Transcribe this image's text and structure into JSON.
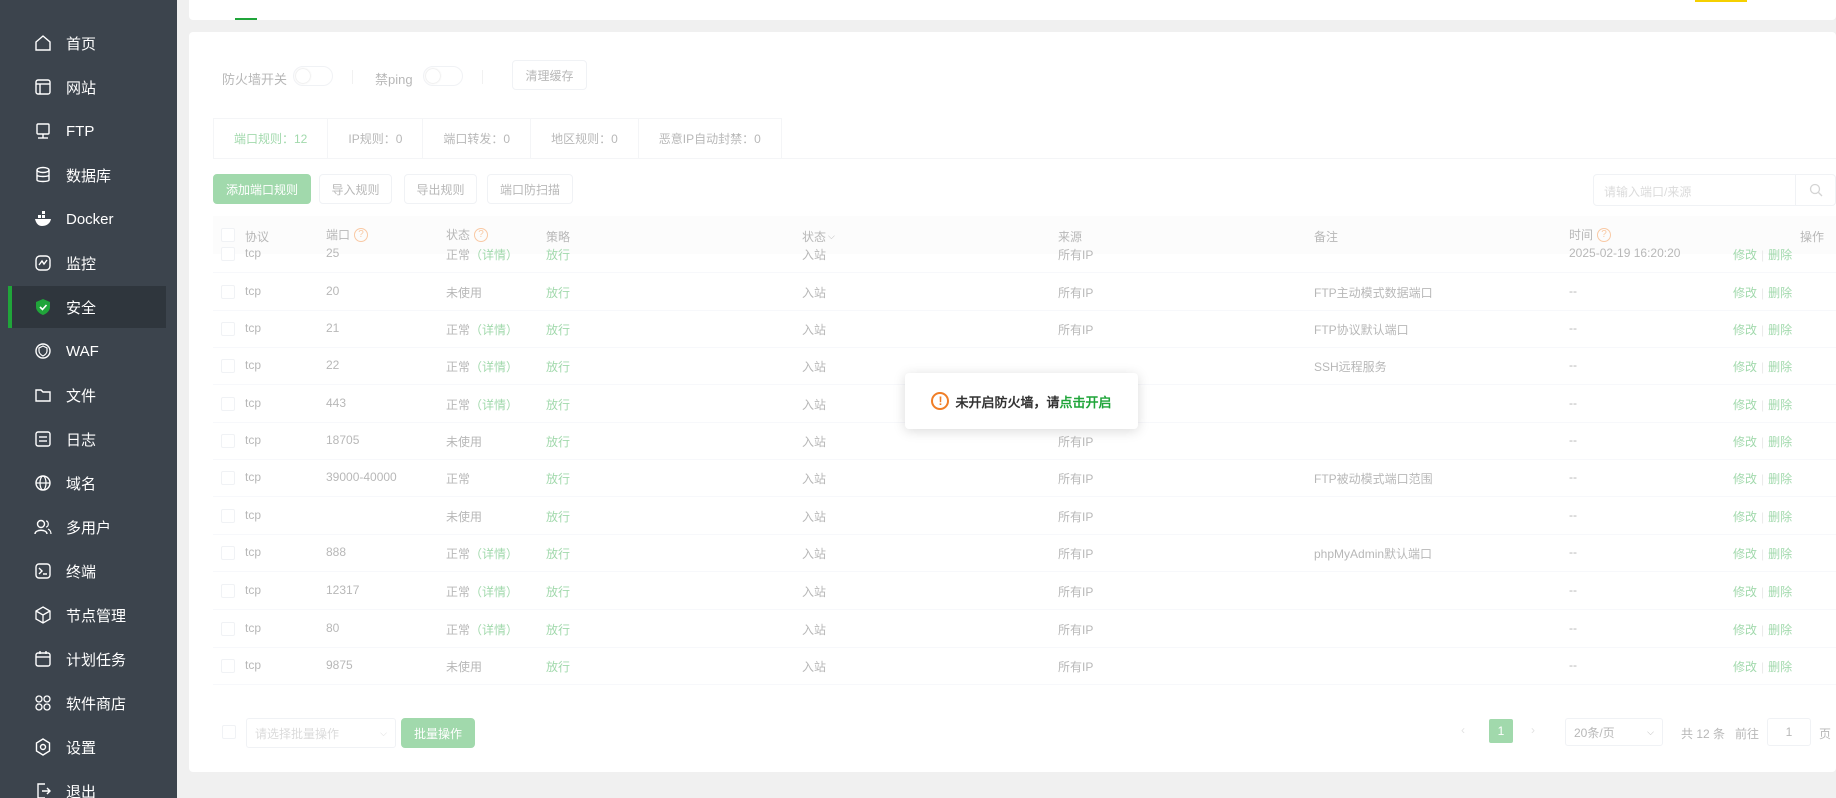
{
  "sidebar": {
    "items": [
      {
        "label": "首页",
        "icon": "home-icon",
        "active": false
      },
      {
        "label": "网站",
        "icon": "website-icon",
        "active": false
      },
      {
        "label": "FTP",
        "icon": "ftp-icon",
        "active": false
      },
      {
        "label": "数据库",
        "icon": "database-icon",
        "active": false
      },
      {
        "label": "Docker",
        "icon": "docker-icon",
        "active": false
      },
      {
        "label": "监控",
        "icon": "monitor-icon",
        "active": false
      },
      {
        "label": "安全",
        "icon": "shield-icon",
        "active": true
      },
      {
        "label": "WAF",
        "icon": "waf-icon",
        "active": false
      },
      {
        "label": "文件",
        "icon": "folder-icon",
        "active": false
      },
      {
        "label": "日志",
        "icon": "log-icon",
        "active": false
      },
      {
        "label": "域名",
        "icon": "globe-icon",
        "active": false
      },
      {
        "label": "多用户",
        "icon": "users-icon",
        "active": false
      },
      {
        "label": "终端",
        "icon": "terminal-icon",
        "active": false
      },
      {
        "label": "节点管理",
        "icon": "cube-icon",
        "active": false
      },
      {
        "label": "计划任务",
        "icon": "calendar-icon",
        "active": false
      },
      {
        "label": "软件商店",
        "icon": "apps-icon",
        "active": false
      },
      {
        "label": "设置",
        "icon": "gear-icon",
        "active": false
      },
      {
        "label": "退出",
        "icon": "logout-icon",
        "active": false
      }
    ]
  },
  "toolbar": {
    "firewall_label": "防火墙开关",
    "ping_label": "禁ping",
    "clear_cache": "清理缓存"
  },
  "tabs": [
    {
      "label": "端口规则：12",
      "active": true
    },
    {
      "label": "IP规则：0",
      "active": false
    },
    {
      "label": "端口转发：0",
      "active": false
    },
    {
      "label": "地区规则：0",
      "active": false
    },
    {
      "label": "恶意IP自动封禁：0",
      "active": false
    }
  ],
  "actions": {
    "add": "添加端口规则",
    "import": "导入规则",
    "export": "导出规则",
    "scan": "端口防扫描"
  },
  "search": {
    "placeholder": "请输入端口/来源"
  },
  "table": {
    "headers": {
      "protocol": "协议",
      "port": "端口",
      "status": "状态",
      "policy": "策略",
      "direction": "状态",
      "source": "来源",
      "remark": "备注",
      "time": "时间",
      "ops": "操作"
    },
    "rows": [
      {
        "protocol": "tcp",
        "port": "25",
        "status": "正常",
        "detail": "（详情）",
        "policy": "放行",
        "direction": "入站",
        "source": "所有IP",
        "remark": "",
        "time": "2025-02-19 16:20:20"
      },
      {
        "protocol": "tcp",
        "port": "20",
        "status": "未使用",
        "detail": "",
        "policy": "放行",
        "direction": "入站",
        "source": "所有IP",
        "remark": "FTP主动模式数据端口",
        "time": "--"
      },
      {
        "protocol": "tcp",
        "port": "21",
        "status": "正常",
        "detail": "（详情）",
        "policy": "放行",
        "direction": "入站",
        "source": "所有IP",
        "remark": "FTP协议默认端口",
        "time": "--"
      },
      {
        "protocol": "tcp",
        "port": "22",
        "status": "正常",
        "detail": "（详情）",
        "policy": "放行",
        "direction": "入站",
        "source": "",
        "remark": "SSH远程服务",
        "time": "--"
      },
      {
        "protocol": "tcp",
        "port": "443",
        "status": "正常",
        "detail": "（详情）",
        "policy": "放行",
        "direction": "入站",
        "source": "",
        "remark": "",
        "time": "--"
      },
      {
        "protocol": "tcp",
        "port": "18705",
        "status": "未使用",
        "detail": "",
        "policy": "放行",
        "direction": "入站",
        "source": "所有IP",
        "remark": "",
        "time": "--"
      },
      {
        "protocol": "tcp",
        "port": "39000-40000",
        "status": "正常",
        "detail": "",
        "policy": "放行",
        "direction": "入站",
        "source": "所有IP",
        "remark": "FTP被动模式端口范围",
        "time": "--"
      },
      {
        "protocol": "tcp",
        "port": "",
        "status": "未使用",
        "detail": "",
        "policy": "放行",
        "direction": "入站",
        "source": "所有IP",
        "remark": "",
        "time": "--"
      },
      {
        "protocol": "tcp",
        "port": "888",
        "status": "正常",
        "detail": "（详情）",
        "policy": "放行",
        "direction": "入站",
        "source": "所有IP",
        "remark": "phpMyAdmin默认端口",
        "time": "--"
      },
      {
        "protocol": "tcp",
        "port": "12317",
        "status": "正常",
        "detail": "（详情）",
        "policy": "放行",
        "direction": "入站",
        "source": "所有IP",
        "remark": "",
        "time": "--"
      },
      {
        "protocol": "tcp",
        "port": "80",
        "status": "正常",
        "detail": "（详情）",
        "policy": "放行",
        "direction": "入站",
        "source": "所有IP",
        "remark": "",
        "time": "--"
      },
      {
        "protocol": "tcp",
        "port": "9875",
        "status": "未使用",
        "detail": "",
        "policy": "放行",
        "direction": "入站",
        "source": "所有IP",
        "remark": "",
        "time": "--"
      }
    ],
    "edit": "修改",
    "delete": "删除"
  },
  "footer": {
    "batch_placeholder": "请选择批量操作",
    "batch_button": "批量操作",
    "current_page": "1",
    "page_size": "20条/页",
    "total": "共 12 条",
    "goto": "前往",
    "goto_value": "1",
    "page_suffix": "页"
  },
  "popup": {
    "text": "未开启防火墙，请",
    "link": "点击开启"
  },
  "colors": {
    "accent": "#20a53a",
    "sidebar": "#3c444d",
    "warning": "#f07e27"
  }
}
